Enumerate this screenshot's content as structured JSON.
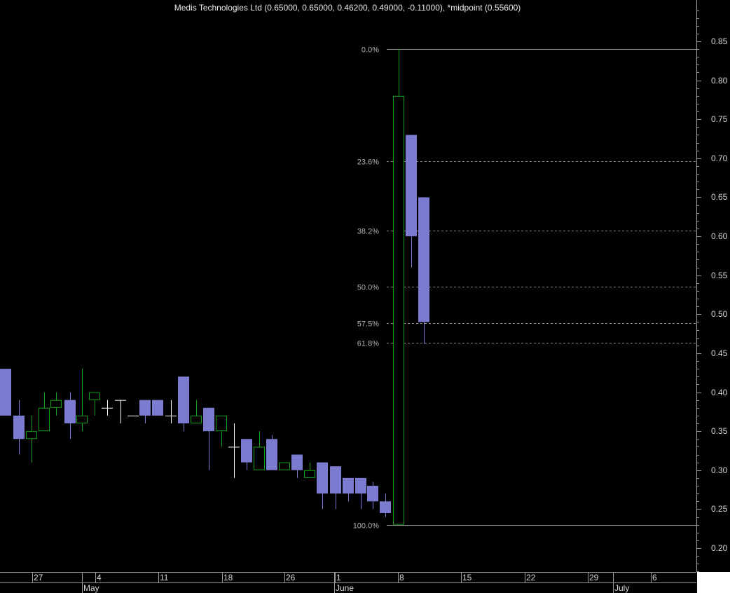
{
  "chart_data": {
    "type": "candlestick",
    "title": "Medis Technologies Ltd (0.65000, 0.65000, 0.46200, 0.49000, -0.11000), *midpoint (0.55600)",
    "ylim": [
      0.165,
      0.9
    ],
    "y_ticks": [
      "0.85",
      "0.80",
      "0.75",
      "0.70",
      "0.65",
      "0.60",
      "0.55",
      "0.50",
      "0.45",
      "0.40",
      "0.35",
      "0.30",
      "0.25",
      "0.20"
    ],
    "x_tick_labels": [
      "27",
      "4",
      "11",
      "18",
      "26",
      "1",
      "8",
      "15",
      "22",
      "29",
      "6"
    ],
    "month_labels": [
      "May",
      "June",
      "July"
    ],
    "colors": {
      "up": "#14a014",
      "down": "#7b7bcf",
      "neutral": "#ffffff",
      "fib": "#8c8c8c"
    },
    "fibonacci": {
      "high": 0.84,
      "low": 0.23,
      "levels": [
        {
          "label": "0.0%",
          "value": 0.84,
          "style": "solid"
        },
        {
          "label": "23.6%",
          "value": 0.696,
          "style": "dashed"
        },
        {
          "label": "38.2%",
          "value": 0.607,
          "style": "dashed"
        },
        {
          "label": "50.0%",
          "value": 0.535,
          "style": "dashed"
        },
        {
          "label": "57.5%",
          "value": 0.489,
          "style": "dashed"
        },
        {
          "label": "61.8%",
          "value": 0.463,
          "style": "dashed"
        },
        {
          "label": "100.0%",
          "value": 0.23,
          "style": "solid"
        }
      ]
    },
    "series": [
      {
        "date": "Apr 23",
        "open": 0.43,
        "high": 0.43,
        "low": 0.37,
        "close": 0.37
      },
      {
        "date": "Apr 24",
        "open": 0.37,
        "high": 0.39,
        "low": 0.32,
        "close": 0.34
      },
      {
        "date": "Apr 27",
        "open": 0.34,
        "high": 0.37,
        "low": 0.31,
        "close": 0.35
      },
      {
        "date": "Apr 28",
        "open": 0.35,
        "high": 0.4,
        "low": 0.35,
        "close": 0.38
      },
      {
        "date": "Apr 29",
        "open": 0.38,
        "high": 0.4,
        "low": 0.37,
        "close": 0.39
      },
      {
        "date": "Apr 30",
        "open": 0.39,
        "high": 0.4,
        "low": 0.34,
        "close": 0.36
      },
      {
        "date": "May 1",
        "open": 0.36,
        "high": 0.43,
        "low": 0.35,
        "close": 0.37
      },
      {
        "date": "May 4",
        "open": 0.39,
        "high": 0.4,
        "low": 0.37,
        "close": 0.4
      },
      {
        "date": "May 5",
        "open": 0.38,
        "high": 0.39,
        "low": 0.37,
        "close": 0.38
      },
      {
        "date": "May 6",
        "open": 0.39,
        "high": 0.39,
        "low": 0.36,
        "close": 0.39
      },
      {
        "date": "May 7",
        "open": 0.37,
        "high": 0.37,
        "low": 0.37,
        "close": 0.37
      },
      {
        "date": "May 8",
        "open": 0.39,
        "high": 0.39,
        "low": 0.36,
        "close": 0.37
      },
      {
        "date": "May 11",
        "open": 0.39,
        "high": 0.39,
        "low": 0.37,
        "close": 0.37
      },
      {
        "date": "May 12",
        "open": 0.37,
        "high": 0.39,
        "low": 0.36,
        "close": 0.37
      },
      {
        "date": "May 13",
        "open": 0.42,
        "high": 0.42,
        "low": 0.35,
        "close": 0.36
      },
      {
        "date": "May 14",
        "open": 0.36,
        "high": 0.39,
        "low": 0.36,
        "close": 0.37
      },
      {
        "date": "May 15",
        "open": 0.38,
        "high": 0.38,
        "low": 0.3,
        "close": 0.35
      },
      {
        "date": "May 18",
        "open": 0.35,
        "high": 0.37,
        "low": 0.33,
        "close": 0.37
      },
      {
        "date": "May 19",
        "open": 0.33,
        "high": 0.36,
        "low": 0.29,
        "close": 0.33
      },
      {
        "date": "May 20",
        "open": 0.34,
        "high": 0.34,
        "low": 0.3,
        "close": 0.31
      },
      {
        "date": "May 21",
        "open": 0.3,
        "high": 0.35,
        "low": 0.3,
        "close": 0.33
      },
      {
        "date": "May 22",
        "open": 0.34,
        "high": 0.345,
        "low": 0.3,
        "close": 0.3
      },
      {
        "date": "May 26",
        "open": 0.3,
        "high": 0.31,
        "low": 0.3,
        "close": 0.31
      },
      {
        "date": "May 27",
        "open": 0.32,
        "high": 0.32,
        "low": 0.29,
        "close": 0.3
      },
      {
        "date": "May 28",
        "open": 0.29,
        "high": 0.31,
        "low": 0.29,
        "close": 0.3
      },
      {
        "date": "May 29",
        "open": 0.31,
        "high": 0.31,
        "low": 0.25,
        "close": 0.27
      },
      {
        "date": "Jun 1",
        "open": 0.305,
        "high": 0.305,
        "low": 0.25,
        "close": 0.27
      },
      {
        "date": "Jun 2",
        "open": 0.29,
        "high": 0.29,
        "low": 0.26,
        "close": 0.27
      },
      {
        "date": "Jun 3",
        "open": 0.29,
        "high": 0.29,
        "low": 0.25,
        "close": 0.27
      },
      {
        "date": "Jun 4",
        "open": 0.28,
        "high": 0.285,
        "low": 0.25,
        "close": 0.26
      },
      {
        "date": "Jun 5",
        "open": 0.26,
        "high": 0.27,
        "low": 0.24,
        "close": 0.245
      },
      {
        "date": "Jun 8",
        "open": 0.23,
        "high": 0.84,
        "low": 0.23,
        "close": 0.78
      },
      {
        "date": "Jun 9",
        "open": 0.73,
        "high": 0.73,
        "low": 0.56,
        "close": 0.6
      },
      {
        "date": "Jun 10",
        "open": 0.65,
        "high": 0.65,
        "low": 0.462,
        "close": 0.49
      }
    ]
  }
}
